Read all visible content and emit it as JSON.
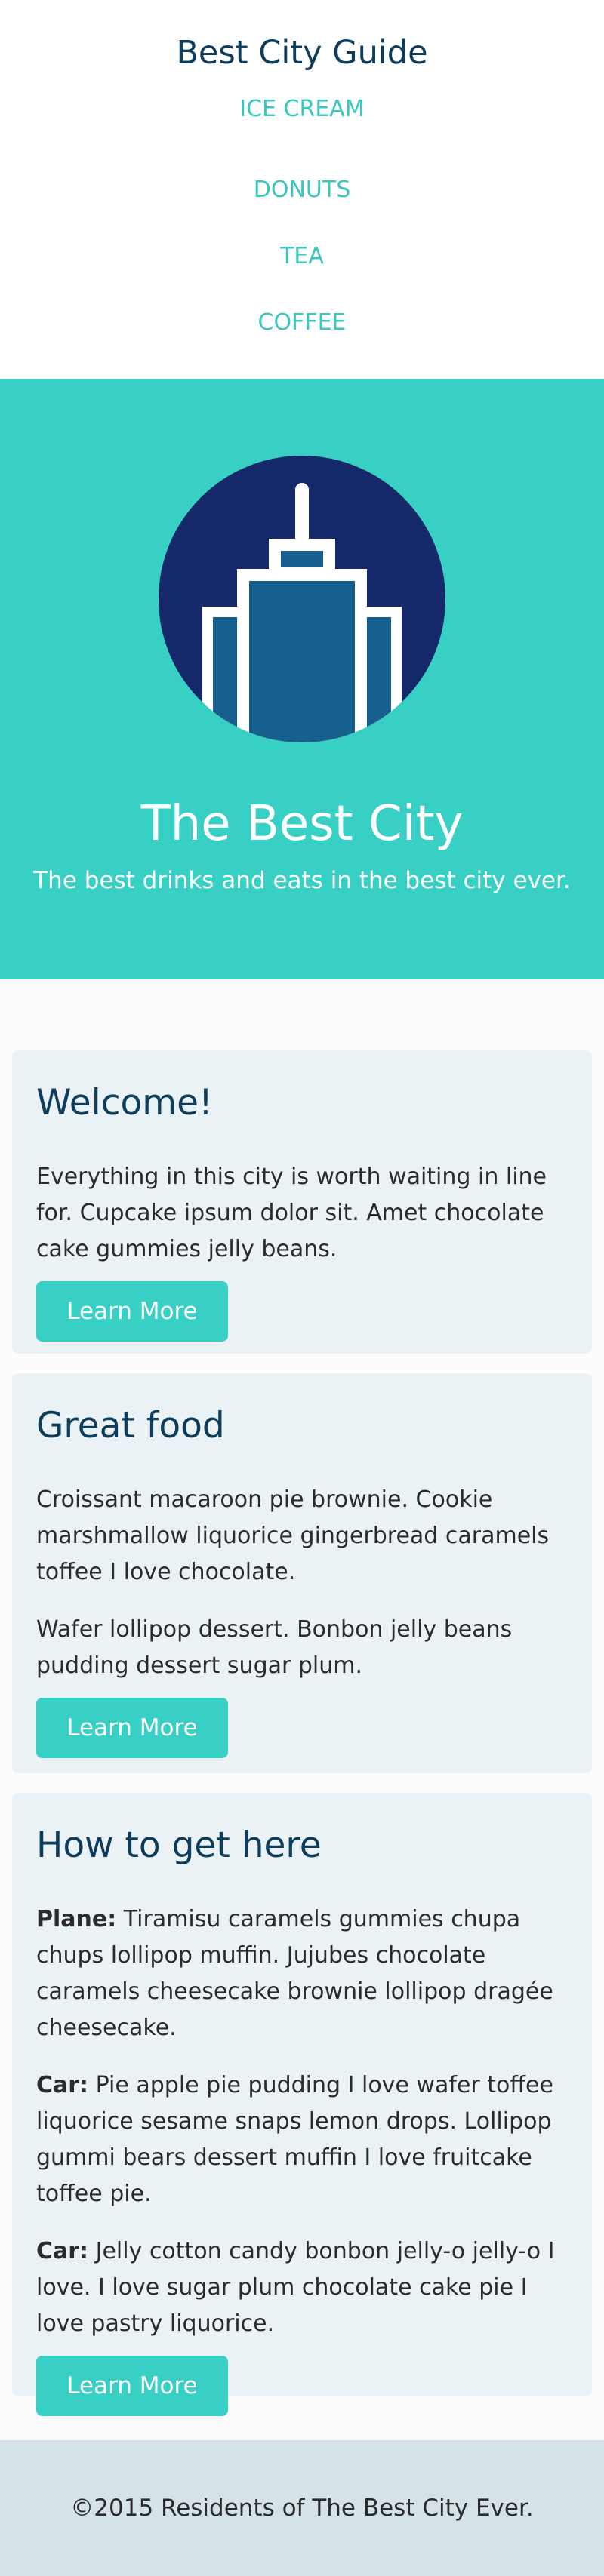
{
  "header": {
    "title": "Best City Guide",
    "nav": [
      "ICE CREAM",
      "DONUTS",
      "TEA",
      "COFFEE"
    ]
  },
  "hero": {
    "title": "The Best City",
    "subtitle": "The best drinks and eats in the best city ever.",
    "bg_color": "#38d0c4",
    "logo_icon": "city-skyscraper-icon"
  },
  "cards": [
    {
      "title": "Welcome!",
      "paragraphs": [
        {
          "lead": "",
          "text": "Everything in this city is worth waiting in line for. Cupcake ipsum dolor sit. Amet chocolate cake gummies jelly beans."
        }
      ],
      "button": "Learn More"
    },
    {
      "title": "Great food",
      "paragraphs": [
        {
          "lead": "",
          "text": "Croissant macaroon pie brownie. Cookie marshmallow liquorice gingerbread caramels toffee I love chocolate."
        },
        {
          "lead": "",
          "text": "Wafer lollipop dessert. Bonbon jelly beans pudding dessert sugar plum."
        }
      ],
      "button": "Learn More"
    },
    {
      "title": "How to get here",
      "paragraphs": [
        {
          "lead": "Plane:",
          "text": " Tiramisu caramels gummies chupa chups lollipop muffin. Jujubes chocolate caramels cheesecake brownie lollipop dragée cheesecake."
        },
        {
          "lead": "Car:",
          "text": " Pie apple pie pudding I love wafer toffee liquorice sesame snaps lemon drops. Lollipop gummi bears dessert muffin I love fruitcake toffee pie."
        },
        {
          "lead": "Car:",
          "text": " Jelly cotton candy bonbon jelly-o jelly-o I love. I love sugar plum chocolate cake pie I love pastry liquorice."
        }
      ],
      "button": "Learn More"
    }
  ],
  "footer": {
    "text": "©2015 Residents of The Best City Ever."
  }
}
